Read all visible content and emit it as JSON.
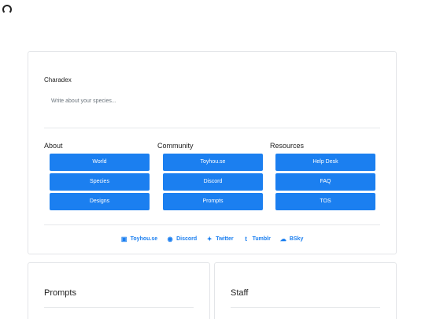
{
  "header": {
    "site_title": "Charadex",
    "intro_text": "Write about your species..."
  },
  "columns": [
    {
      "heading": "About",
      "buttons": [
        "World",
        "Species",
        "Designs"
      ]
    },
    {
      "heading": "Community",
      "buttons": [
        "Toyhou.se",
        "Discord",
        "Prompts"
      ]
    },
    {
      "heading": "Resources",
      "buttons": [
        "Help Desk",
        "FAQ",
        "TOS"
      ]
    }
  ],
  "social": [
    {
      "label": "Toyhou.se",
      "icon": "toyhouse-icon"
    },
    {
      "label": "Discord",
      "icon": "discord-icon"
    },
    {
      "label": "Twitter",
      "icon": "twitter-icon"
    },
    {
      "label": "Tumblr",
      "icon": "tumblr-icon"
    },
    {
      "label": "BSky",
      "icon": "bluesky-icon"
    }
  ],
  "sections": {
    "prompts_title": "Prompts",
    "staff_title": "Staff"
  },
  "colors": {
    "accent": "#1b7ff0",
    "border": "#e3e5e8"
  }
}
